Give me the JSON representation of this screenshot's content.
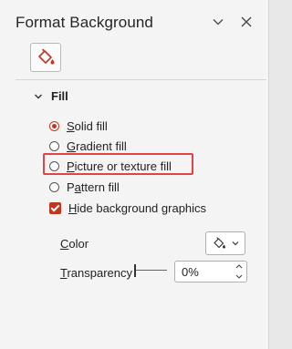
{
  "pane": {
    "title": "Format Background"
  },
  "header_icons": {
    "chevron": "chevron-down-icon",
    "close": "close-icon"
  },
  "tab": {
    "icon": "fill-bucket-icon"
  },
  "fill_section": {
    "title": "Fill",
    "options": [
      {
        "label": "Solid fill",
        "selected": true,
        "underline": "S",
        "rest": "olid fill"
      },
      {
        "label": "Gradient fill",
        "selected": false,
        "underline": "G",
        "rest": "radient fill"
      },
      {
        "label": "Picture or texture fill",
        "selected": false,
        "underline": "P",
        "rest": "icture or texture fill"
      },
      {
        "label": "Pattern fill",
        "selected": false,
        "underline": "",
        "pre": "P",
        "ul": "a",
        "post": "ttern fill"
      }
    ],
    "hide_bg": {
      "label": "Hide background graphics",
      "checked": true,
      "underline": "H",
      "rest": "ide background graphics"
    }
  },
  "color": {
    "label": "Color",
    "underline": "C",
    "rest": "olor"
  },
  "transparency": {
    "label": "Transparency",
    "underline": "T",
    "rest": "ransparency",
    "value": "0%"
  },
  "colors": {
    "accent": "#c4351e",
    "highlight_border": "#e04545"
  }
}
